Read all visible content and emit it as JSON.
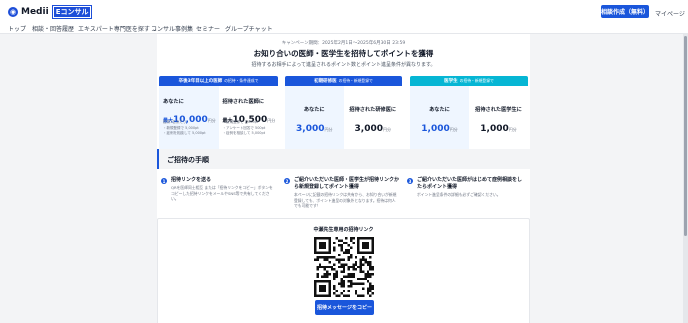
{
  "header": {
    "logo_text": "Medii",
    "logo_badge": "Eコンサル",
    "cta_button": "相談作成（無料）",
    "mypage_link": "マイページ"
  },
  "nav": {
    "items": [
      {
        "label": "トップ"
      },
      {
        "label": "相談・回答履歴"
      },
      {
        "label": "エキスパート専門医を探す"
      },
      {
        "label": "コンサル事例集"
      },
      {
        "label": "セミナー"
      },
      {
        "label": "グループチャット"
      }
    ]
  },
  "hero": {
    "campaign_period": "キャンペーン期間：2025年2月1日〜2025年6月30日 23:59",
    "headline": "お知り合いの医師・医学生を招待してポイントを獲得",
    "subline": "招待するお相手によって進呈されるポイント数とポイント進呈条件が異なります。"
  },
  "cards": [
    {
      "header": "卒後3年目以上の医師",
      "header_small": "の招待・条件達成で",
      "left_label": "あなたに",
      "left_prefix": "最大",
      "left_amount": "10,000",
      "left_unit": "円分",
      "left_notes": [
        "招待1名あたり",
        "・新規登録で 5,000pt",
        "・症例を相談して 5,000pt"
      ],
      "right_label": "招待された医師に",
      "right_prefix": "最大",
      "right_amount": "10,500",
      "right_unit": "円分",
      "right_notes": [
        "・新規登録で 5,000pt",
        "・アンケート回答で 500pt",
        "・症例を相談して 5,000pt"
      ]
    },
    {
      "header": "初期研修医",
      "header_small": "の招待・新規登録で",
      "left_label": "あなたに",
      "left_amount": "3,000",
      "left_unit": "円分",
      "right_label": "招待された研修医に",
      "right_amount": "3,000",
      "right_unit": "円分"
    },
    {
      "header": "医学生",
      "header_small": "の招待・新規登録で",
      "left_label": "あなたに",
      "left_amount": "1,000",
      "left_unit": "円分",
      "right_label": "招待された医学生に",
      "right_amount": "1,000",
      "right_unit": "円分"
    }
  ],
  "steps": {
    "title": "ご招待の手順",
    "items": [
      {
        "num": "1",
        "title": "招待リンクを送る",
        "desc": "QRを医師同士相互 または「招待リンクをコピー」ボタンをコピーした招待リンクをメールやSNS等で共有してください。"
      },
      {
        "num": "2",
        "title": "ご紹介いただいた医師・医学生が招待リンクから新規登録してポイント獲得",
        "desc": "本ページに記載の招待リンクは共有から、お知り合いが新規登録しても、ポイント進呈の対象外となります。招待は何人でも可能です！"
      },
      {
        "num": "3",
        "title": "ご紹介いただいた医師がはじめて症例相談をしたらポイント獲得",
        "desc": "ポイント進呈条件の詳細も必ずご確認ください。"
      }
    ]
  },
  "qr": {
    "title": "中瀬先生専用の招待リンク",
    "copy_button": "招待メッセージをコピー"
  },
  "colors": {
    "primary": "#1a56db",
    "cyan": "#06b6d4",
    "card_bg": "#eff6ff"
  }
}
